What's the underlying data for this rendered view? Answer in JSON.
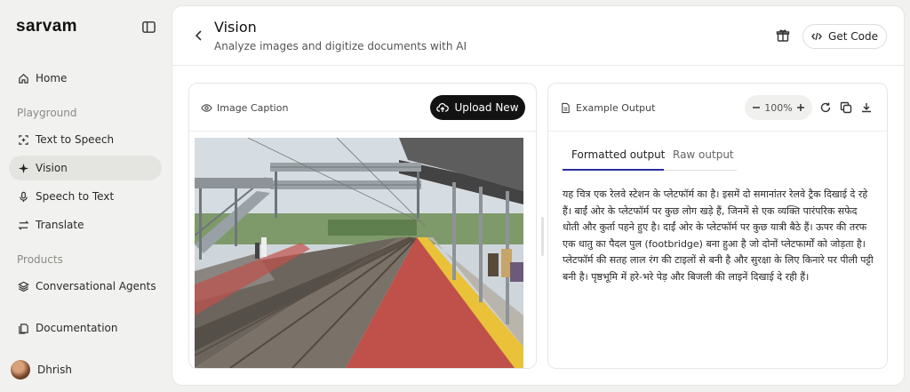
{
  "brand": {
    "logo_text": "sarvam"
  },
  "sidebar": {
    "items": [
      {
        "label": "Home",
        "icon": "home-icon"
      },
      {
        "label": "Text to Speech",
        "icon": "text-speech-icon"
      },
      {
        "label": "Vision",
        "icon": "sparkle-icon",
        "active": true
      },
      {
        "label": "Speech to Text",
        "icon": "mic-icon"
      },
      {
        "label": "Translate",
        "icon": "translate-icon"
      },
      {
        "label": "Conversational Agents",
        "icon": "layers-icon"
      },
      {
        "label": "Documentation",
        "icon": "doc-icon"
      }
    ],
    "sections": {
      "playground": "Playground",
      "products": "Products"
    },
    "user": {
      "name": "Dhrish"
    }
  },
  "header": {
    "title": "Vision",
    "subtitle": "Analyze images and digitize documents with AI",
    "get_code_label": "Get Code"
  },
  "left_panel": {
    "label": "Image Caption",
    "upload_label": "Upload New"
  },
  "right_panel": {
    "label": "Example Output",
    "zoom": "100%",
    "tabs": [
      "Formatted output",
      "Raw output"
    ],
    "active_tab": 0,
    "output_text": "यह चित्र एक रेलवे स्टेशन के प्लेटफॉर्म का है। इसमें दो समानांतर रेलवे ट्रैक दिखाई दे रहे हैं। बाईं ओर के प्लेटफॉर्म पर कुछ लोग खड़े हैं, जिनमें से एक व्यक्ति पारंपरिक सफेद धोती और कुर्ता पहने हुए है। दाईं ओर के प्लेटफॉर्म पर कुछ यात्री बैठे हैं। ऊपर की तरफ एक धातु का पैदल पुल (footbridge) बना हुआ है जो दोनों प्लेटफार्मों को जोड़ता है। प्लेटफॉर्म की सतह लाल रंग की टाइलों से बनी है और सुरक्षा के लिए किनारे पर पीली पट्टी बनी है। पृष्ठभूमि में हरे-भरे पेड़ और बिजली की लाइनें दिखाई दे रही हैं।"
  },
  "colors": {
    "accent": "#2a2f9c",
    "upload_bg": "#121212",
    "platform": "#c0504a",
    "stripe": "#e9c23a"
  }
}
